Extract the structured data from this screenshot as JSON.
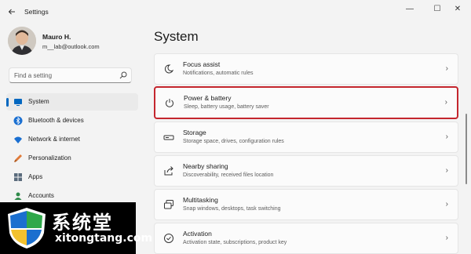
{
  "window": {
    "title": "Settings",
    "back_icon": "back-arrow-icon",
    "controls": {
      "minimize": "—",
      "maximize": "☐",
      "close": "✕"
    }
  },
  "profile": {
    "name": "Mauro H.",
    "email": "m__lab@outlook.com"
  },
  "search": {
    "placeholder": "Find a setting",
    "icon": "search-icon"
  },
  "sidebar": {
    "items": [
      {
        "label": "System",
        "icon": "system-display-icon",
        "selected": true
      },
      {
        "label": "Bluetooth & devices",
        "icon": "bluetooth-icon"
      },
      {
        "label": "Network & internet",
        "icon": "wifi-icon"
      },
      {
        "label": "Personalization",
        "icon": "brush-icon"
      },
      {
        "label": "Apps",
        "icon": "apps-icon"
      },
      {
        "label": "Accounts",
        "icon": "accounts-icon"
      }
    ]
  },
  "main": {
    "title": "System",
    "cards": [
      {
        "title": "Focus assist",
        "subtitle": "Notifications, automatic rules",
        "icon": "moon-icon"
      },
      {
        "title": "Power & battery",
        "subtitle": "Sleep, battery usage, battery saver",
        "icon": "power-icon",
        "highlighted": true
      },
      {
        "title": "Storage",
        "subtitle": "Storage space, drives, configuration rules",
        "icon": "storage-icon"
      },
      {
        "title": "Nearby sharing",
        "subtitle": "Discoverability, received files location",
        "icon": "share-icon"
      },
      {
        "title": "Multitasking",
        "subtitle": "Snap windows, desktops, task switching",
        "icon": "multitasking-icon"
      },
      {
        "title": "Activation",
        "subtitle": "Activation state, subscriptions, product key",
        "icon": "activation-icon"
      }
    ]
  },
  "watermark": {
    "text": "系统堂",
    "url": "xitongtang.com"
  },
  "colors": {
    "accent": "#0067c0",
    "highlight_border": "#c4262e",
    "background": "#f3f3f3",
    "card": "#fbfbfb"
  }
}
